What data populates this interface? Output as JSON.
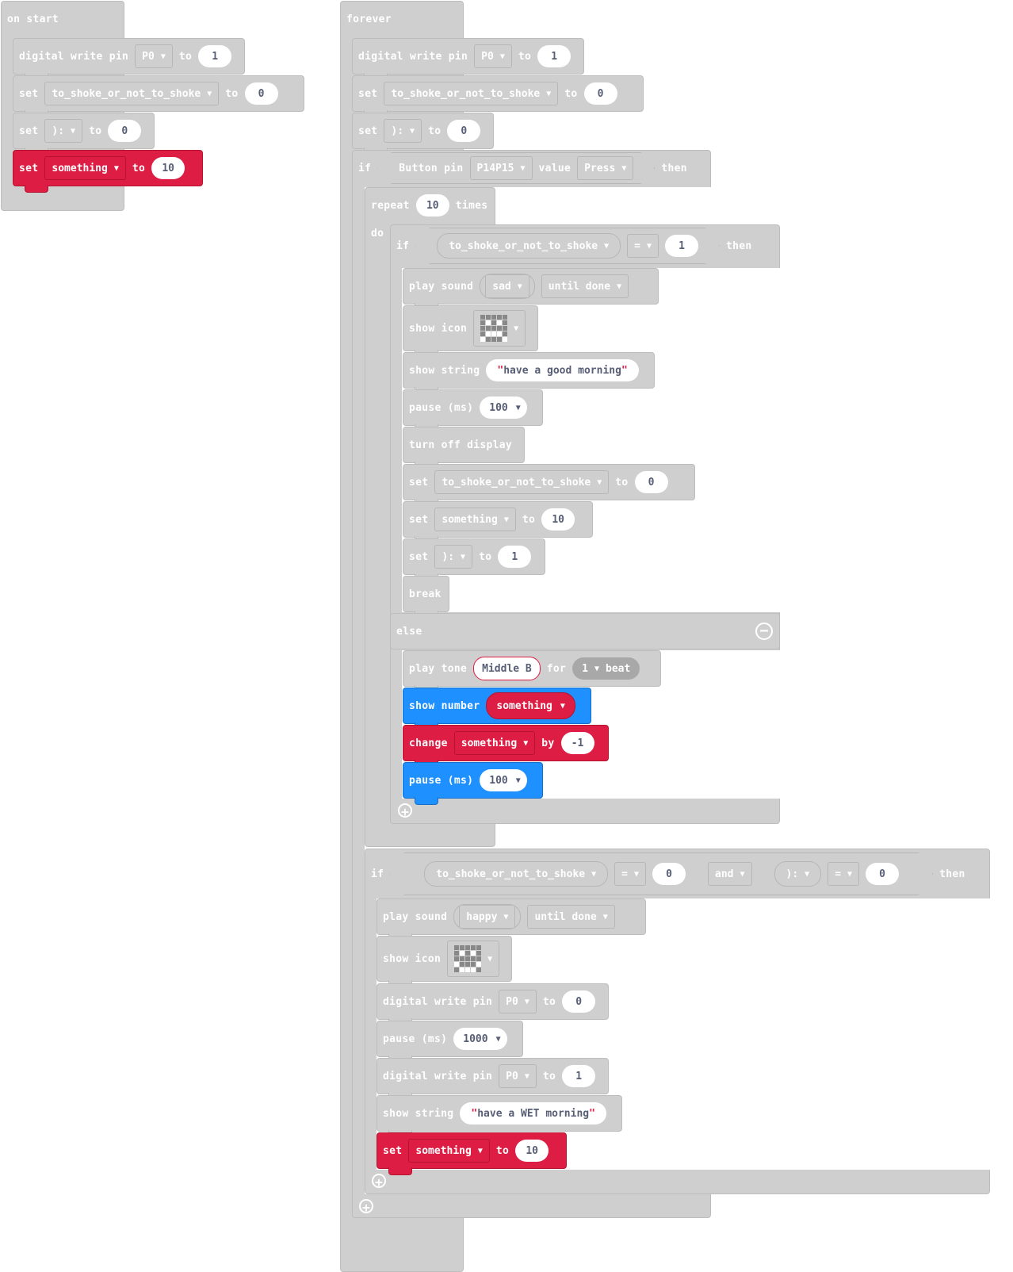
{
  "on_start": {
    "hat": "on start",
    "s1": {
      "kw1": "digital write pin",
      "pin": "P0",
      "kw2": "to",
      "value": "1"
    },
    "s2": {
      "kw1": "set",
      "var": "to_shoke_or_not_to_shoke",
      "kw2": "to",
      "value": "0"
    },
    "s3": {
      "kw1": "set",
      "var": "):",
      "kw2": "to",
      "value": "0"
    },
    "s4": {
      "kw1": "set",
      "var": "something",
      "kw2": "to",
      "value": "10"
    }
  },
  "forever": {
    "hat": "forever",
    "s1": {
      "kw1": "digital write pin",
      "pin": "P0",
      "kw2": "to",
      "value": "1"
    },
    "s2": {
      "kw1": "set",
      "var": "to_shoke_or_not_to_shoke",
      "kw2": "to",
      "value": "0"
    },
    "s3": {
      "kw1": "set",
      "var": "):",
      "kw2": "to",
      "value": "0"
    },
    "if1": {
      "kw_if": "if",
      "kw_button": "Button pin",
      "pin": "P14P15",
      "kw_value": "value",
      "state": "Press",
      "kw_then": "then"
    },
    "repeat": {
      "kw1": "repeat",
      "count": "10",
      "kw2": "times",
      "kw_do": "do"
    },
    "if2": {
      "kw_if": "if",
      "var": "to_shoke_or_not_to_shoke",
      "op": "=",
      "value": "1",
      "kw_then": "then"
    },
    "a1": {
      "kw1": "play sound",
      "sound": "sad",
      "mode": "until done"
    },
    "a2": {
      "kw1": "show icon"
    },
    "a3": {
      "kw1": "show string",
      "text": "have a good morning"
    },
    "a4": {
      "kw1": "pause (ms)",
      "value": "100"
    },
    "a5": {
      "kw1": "turn off display"
    },
    "a6": {
      "kw1": "set",
      "var": "to_shoke_or_not_to_shoke",
      "kw2": "to",
      "value": "0"
    },
    "a7": {
      "kw1": "set",
      "var": "something",
      "kw2": "to",
      "value": "10"
    },
    "a8": {
      "kw1": "set",
      "var": "):",
      "kw2": "to",
      "value": "1"
    },
    "a9": {
      "kw1": "break"
    },
    "else": "else",
    "e1": {
      "kw1": "play tone",
      "note": "Middle B",
      "kw2": "for",
      "beat_num": "1",
      "beat_label": "beat"
    },
    "e2": {
      "kw1": "show number",
      "var": "something"
    },
    "e3": {
      "kw1": "change",
      "var": "something",
      "kw2": "by",
      "value": "-1"
    },
    "e4": {
      "kw1": "pause (ms)",
      "value": "100"
    },
    "if3": {
      "kw_if": "if",
      "var1": "to_shoke_or_not_to_shoke",
      "op1": "=",
      "value1": "0",
      "and": "and",
      "var2": "):",
      "op2": "=",
      "value2": "0",
      "kw_then": "then"
    },
    "b1": {
      "kw1": "play sound",
      "sound": "happy",
      "mode": "until done"
    },
    "b2": {
      "kw1": "show icon"
    },
    "b3": {
      "kw1": "digital write pin",
      "pin": "P0",
      "kw2": "to",
      "value": "0"
    },
    "b4": {
      "kw1": "pause (ms)",
      "value": "1000"
    },
    "b5": {
      "kw1": "digital write pin",
      "pin": "P0",
      "kw2": "to",
      "value": "1"
    },
    "b6": {
      "kw1": "show string",
      "text": "have a WET morning"
    },
    "b7": {
      "kw1": "set",
      "var": "something",
      "kw2": "to",
      "value": "10"
    }
  },
  "colors": {
    "neutral_block": "#cfcfcf",
    "variables": "#dd1d43",
    "basic": "#1e90ff"
  }
}
